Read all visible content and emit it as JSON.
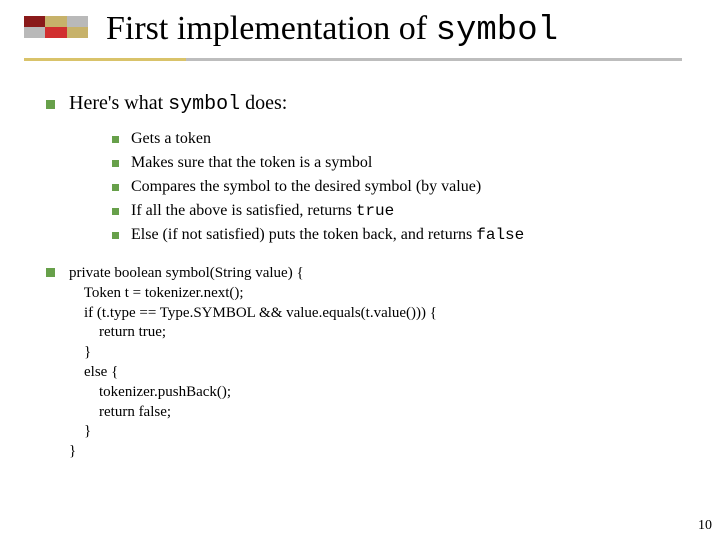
{
  "title": {
    "prefix": "First implementation of ",
    "mono": "symbol"
  },
  "intro": {
    "prefix": "Here's what ",
    "mono": "symbol",
    "suffix": " does:"
  },
  "bullets": [
    {
      "text": "Gets a token"
    },
    {
      "text": "Makes sure that the token is a symbol"
    },
    {
      "text": "Compares the symbol to the desired symbol (by value)"
    },
    {
      "prefix": "If all the above is satisfied, returns ",
      "mono": "true"
    },
    {
      "prefix": "Else (if not satisfied) puts the token back, and returns ",
      "mono": "false"
    }
  ],
  "code": "private boolean symbol(String value) {\n    Token t = tokenizer.next();\n    if (t.type == Type.SYMBOL && value.equals(t.value())) {\n        return true;\n    }\n    else {\n        tokenizer.pushBack();\n        return false;\n    }\n}",
  "page_number": "10"
}
